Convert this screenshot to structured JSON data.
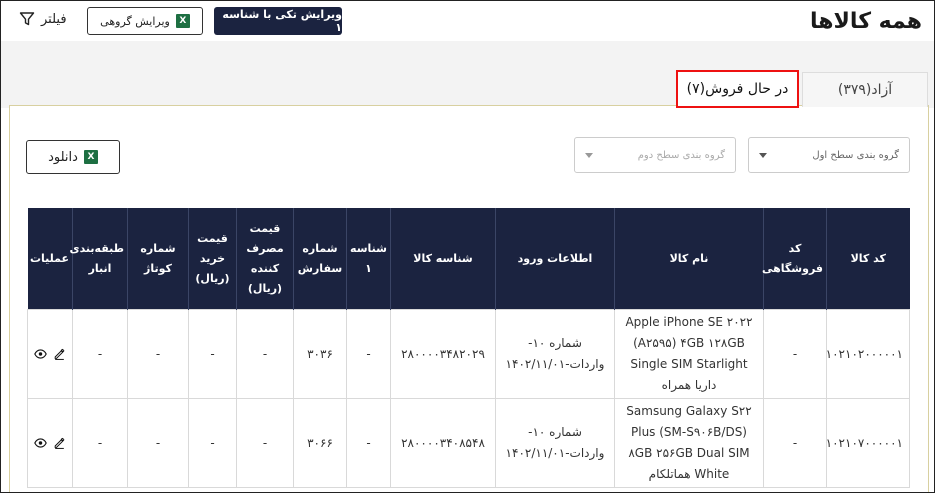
{
  "page": {
    "title": "همه کالاها"
  },
  "toolbar": {
    "filter_label": "فیلتر",
    "group_edit_label": "ویرایش گروهی",
    "single_edit_label": "ویرایش تکی با شناسه ۱"
  },
  "tabs": [
    {
      "label": "آزاد(۳۷۹)",
      "active": false
    },
    {
      "label": "در حال فروش(۷)",
      "active": true
    }
  ],
  "filters": {
    "group_level1_placeholder": "گروه بندی سطح اول",
    "group_level2_placeholder": "گروه بندی سطح دوم"
  },
  "download_label": "دانلود",
  "table": {
    "headers": {
      "product_code": "کد کالا",
      "store_code": "کد فروشگاهی",
      "product_name": "نام کالا",
      "entry_info": "اطلاعات ورود",
      "product_id": "شناسه کالا",
      "id1": "شناسه ۱",
      "order_number": "شماره سفارش",
      "consumer_price": "قیمت مصرف کننده (ریال)",
      "purchase_price": "قیمت خرید (ریال)",
      "short_number": "شماره کوتاژ",
      "warehouse_class": "طبقه‌بندی انبار",
      "operations": "عملیات"
    },
    "rows": [
      {
        "product_code": "۱۰۲۱۰۲۰۰۰۰۰۱",
        "store_code": "-",
        "product_name": "Apple iPhone SE ۲۰۲۲ (A۲۵۹۵) ۴GB ۱۲۸GB Single SIM Starlight داریا همراه",
        "entry_info": "شماره ۱۰- واردات-۱۴۰۲/۱۱/۰۱",
        "product_id": "۲۸۰۰۰۰۳۴۸۲۰۲۹",
        "id1": "-",
        "order_number": "۳۰۳۶",
        "consumer_price": "-",
        "purchase_price": "-",
        "short_number": "-",
        "warehouse_class": "-"
      },
      {
        "product_code": "۱۰۲۱۰۷۰۰۰۰۰۱",
        "store_code": "-",
        "product_name": "Samsung Galaxy S۲۲ Plus (SM-S۹۰۶B/DS) ۸GB ۲۵۶GB Dual SIM White هماتلکام",
        "entry_info": "شماره ۱۰- واردات-۱۴۰۲/۱۱/۰۱",
        "product_id": "۲۸۰۰۰۰۳۴۰۸۵۴۸",
        "id1": "-",
        "order_number": "۳۰۶۶",
        "consumer_price": "-",
        "purchase_price": "-",
        "short_number": "-",
        "warehouse_class": "-"
      }
    ]
  },
  "icons": {
    "filter": "funnel-icon",
    "excel": "excel-icon",
    "view": "eye-icon",
    "edit": "pencil-icon"
  },
  "colors": {
    "primary": "#1b2340",
    "active_tab_border": "#e11111",
    "excel": "#1d6f42"
  }
}
